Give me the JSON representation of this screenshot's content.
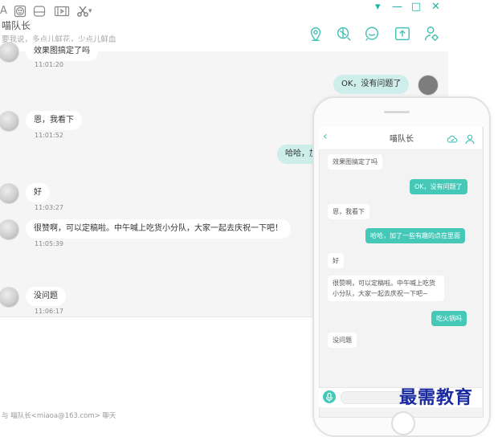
{
  "window": {
    "title": "喵队长",
    "signature": "要我说，多点儿鲜花，少点儿鲜血",
    "controls": {
      "menu": "▾",
      "minimize": "—",
      "maximize": "□",
      "close": "✕"
    },
    "header_icons": [
      "location-icon",
      "tools-icon",
      "chat-bubble-icon",
      "share-icon",
      "person-settings-icon"
    ],
    "accent": "#1bb5a7"
  },
  "messages": [
    {
      "side": "left",
      "text": "效果图搞定了吗",
      "time": "11:01:20"
    },
    {
      "side": "right",
      "text": "OK，没有问题了",
      "time": ""
    },
    {
      "side": "left",
      "text": "恩，我看下",
      "time": "11:01:52"
    },
    {
      "side": "right",
      "text": "哈哈，加",
      "time": ""
    },
    {
      "side": "left",
      "text": "好",
      "time": "11:03:27"
    },
    {
      "side": "left",
      "text": "很赞啊，可以定稿啦。中午喊上吃货小分队，大家一起去庆祝一下吧！",
      "time": "11:05:39"
    },
    {
      "side": "left",
      "text": "没问题",
      "time": "11:06:17"
    }
  ],
  "toolbar": {
    "font_button": "A",
    "scissor_dropdown": "▾"
  },
  "footer": {
    "status": "与 喵队长<miaoa@163.com> 聊天"
  },
  "mobile": {
    "title": "喵队长",
    "back": "‹",
    "messages": [
      {
        "side": "left",
        "text": "效果图搞定了吗"
      },
      {
        "side": "right",
        "text": "OK，没有问题了"
      },
      {
        "side": "left",
        "text": "恩，我看下"
      },
      {
        "side": "right",
        "text": "哈哈，加了一些有趣的点在里面"
      },
      {
        "side": "left",
        "text": "好"
      },
      {
        "side": "left",
        "text": "很赞啊，可以定稿啦。中午喊上吃货小分队，大家一起去庆祝一下吧~"
      },
      {
        "side": "right",
        "text": "吃火锅吗"
      },
      {
        "side": "left",
        "text": "没问题"
      }
    ]
  },
  "watermark": "最需教育"
}
